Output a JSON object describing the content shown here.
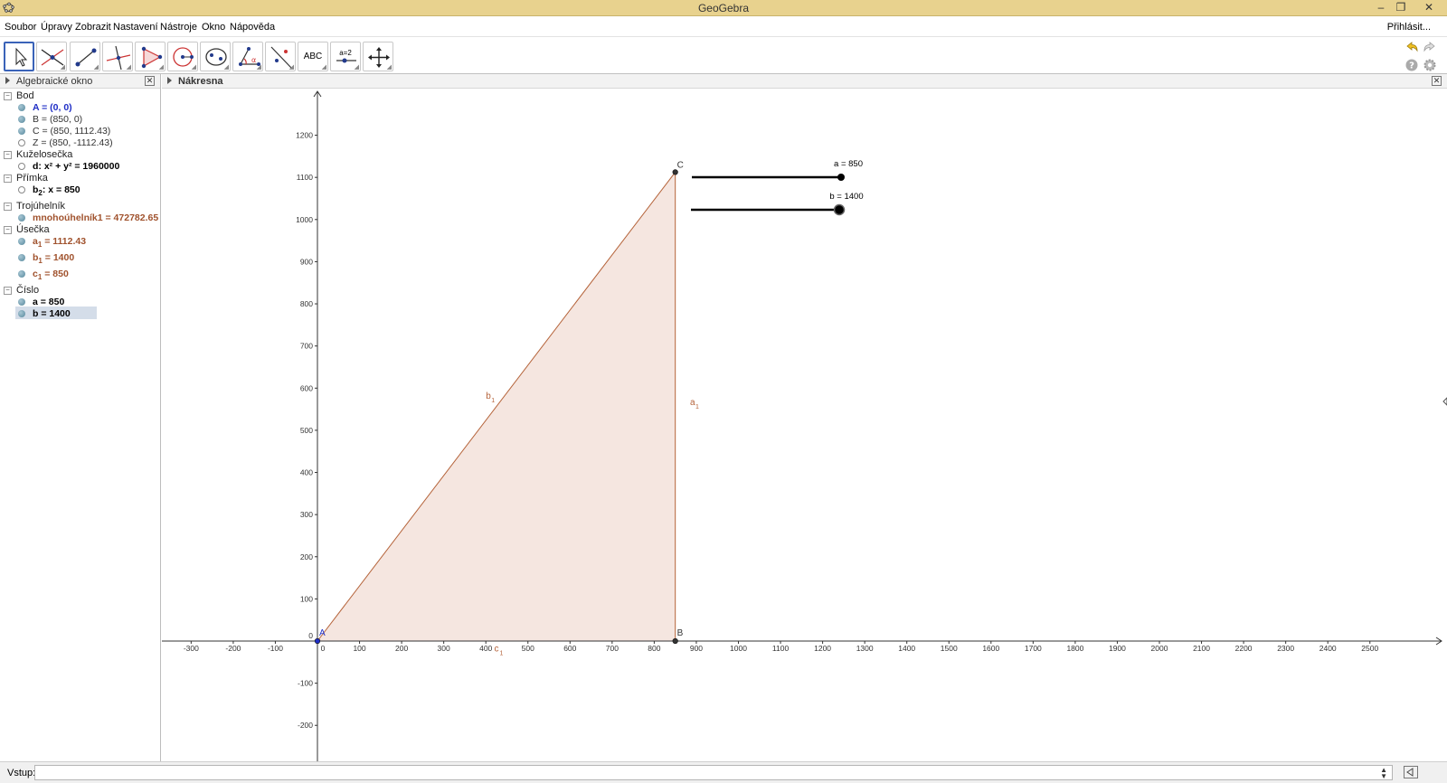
{
  "window": {
    "title": "GeoGebra",
    "minimize": "–",
    "restore": "❐",
    "close": "✕"
  },
  "menu": {
    "items": [
      "Soubor",
      "Úpravy",
      "Zobrazit",
      "Nastavení",
      "Nástroje",
      "Okno",
      "Nápověda"
    ],
    "login": "Přihlásit..."
  },
  "toolbar": {
    "tools": [
      "move-tool",
      "point-tool",
      "line-tool",
      "perpendicular-line-tool",
      "polygon-tool",
      "circle-tool",
      "ellipse-tool",
      "angle-tool",
      "reflect-tool",
      "text-tool",
      "slider-tool",
      "move-graphics-tool"
    ],
    "text_tool_label": "ABC",
    "slider_tool_label": "a=2"
  },
  "algebra": {
    "title": "Algebraické okno",
    "categories": [
      {
        "name": "Bod",
        "items": [
          {
            "text": "A = (0, 0)",
            "color": "#1f2ec6",
            "bold": true,
            "visible": true
          },
          {
            "text": "B = (850, 0)",
            "color": "#333333",
            "bold": false,
            "visible": true
          },
          {
            "text": "C = (850, 1112.43)",
            "color": "#333333",
            "bold": false,
            "visible": true
          },
          {
            "text": "Z = (850, -1112.43)",
            "color": "#333333",
            "bold": false,
            "visible": false
          }
        ]
      },
      {
        "name": "Kuželosečka",
        "items": [
          {
            "text": "d: x² + y² = 1960000",
            "color": "#000000",
            "bold": true,
            "visible": false
          }
        ]
      },
      {
        "name": "Přímka",
        "items": [
          {
            "text": "b",
            "sub": "2",
            "rest": ": x = 850",
            "color": "#000000",
            "bold": true,
            "visible": false
          }
        ]
      },
      {
        "name": "Trojúhelník",
        "items": [
          {
            "text": "mnohoúhelník1 = 472782.65",
            "color": "#a0522d",
            "bold": true,
            "visible": true
          }
        ]
      },
      {
        "name": "Úsečka",
        "items": [
          {
            "text": "a",
            "sub": "1",
            "rest": " = 1112.43",
            "color": "#a0522d",
            "bold": true,
            "visible": true
          },
          {
            "text": "b",
            "sub": "1",
            "rest": " = 1400",
            "color": "#a0522d",
            "bold": true,
            "visible": true
          },
          {
            "text": "c",
            "sub": "1",
            "rest": " = 850",
            "color": "#a0522d",
            "bold": true,
            "visible": true
          }
        ]
      },
      {
        "name": "Číslo",
        "items": [
          {
            "text": "a = 850",
            "color": "#000000",
            "bold": true,
            "visible": true
          },
          {
            "text": "b = 1400",
            "color": "#000000",
            "bold": true,
            "visible": true,
            "selected": true
          }
        ]
      }
    ]
  },
  "graphics": {
    "title": "Nákresna",
    "x_ticks": [
      -300,
      -200,
      -100,
      0,
      100,
      200,
      300,
      400,
      500,
      600,
      700,
      800,
      900,
      1000,
      1100,
      1200,
      1300,
      1400,
      1500,
      1600,
      1700,
      1800,
      1900,
      2000,
      2100,
      2200,
      2300,
      2400,
      2500
    ],
    "y_ticks": [
      -200,
      -100,
      0,
      100,
      200,
      300,
      400,
      500,
      600,
      700,
      800,
      900,
      1000,
      1100,
      1200
    ],
    "points": [
      {
        "name": "A",
        "x": 0,
        "y": 0,
        "color": "#1f2ec6"
      },
      {
        "name": "B",
        "x": 850,
        "y": 0,
        "color": "#333333"
      },
      {
        "name": "C",
        "x": 850,
        "y": 1112.43,
        "color": "#333333"
      }
    ],
    "segment_labels": [
      {
        "name": "b",
        "sub": "1",
        "x": 400,
        "y": 575
      },
      {
        "name": "a",
        "sub": "1",
        "x": 885,
        "y": 560
      },
      {
        "name": "c",
        "sub": "1",
        "x": 420,
        "y": -25
      }
    ],
    "sliders": [
      {
        "label": "a = 850",
        "value": 850
      },
      {
        "label": "b = 1400",
        "value": 1400
      }
    ],
    "polygon_fill": "#f5e6e0",
    "polygon_stroke": "#b5633a"
  },
  "input": {
    "label": "Vstup:",
    "value": ""
  }
}
